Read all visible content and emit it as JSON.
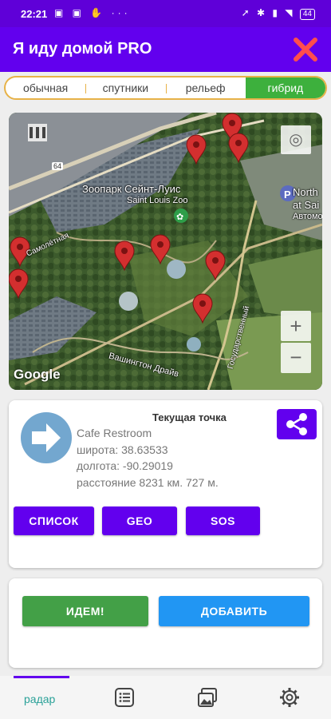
{
  "status": {
    "time": "22:21",
    "left_icons": "▣ ▣ ✋ ···",
    "right_icons": "➚ ✱ ▮ ◥",
    "battery": "44"
  },
  "app": {
    "title": "Я иду домой PRO"
  },
  "map_types": [
    "обычная",
    "спутники",
    "рельеф",
    "гибрид"
  ],
  "map_types_selected": "гибрид",
  "map": {
    "labels": {
      "zoo_ru": "Зоопарк Сейнт-Луис",
      "zoo_en": "Saint Louis Zoo",
      "north1": "North",
      "north2": "at Sai",
      "auto": "Автомо",
      "road1": "Самолётная",
      "road2": "Вашингтон Драйв",
      "road3": "Государственный",
      "shield": "64"
    },
    "google": "Google"
  },
  "current": {
    "title": "Текущая точка",
    "name": "Cafe Restroom",
    "lat": "широта: 38.63533",
    "lon": "долгота: -90.29019",
    "distance": "расстояние 8231 км. 727 м."
  },
  "buttons": {
    "list": "СПИСОК",
    "geo": "GEO",
    "sos": "SOS",
    "go": "ИДЕМ!",
    "add": "ДОБАВИТЬ"
  },
  "nav": {
    "radar": "радар"
  },
  "colors": {
    "primary": "#6200ee",
    "green": "#43a047",
    "blue": "#2196f3",
    "close": "#ff4d4d"
  }
}
